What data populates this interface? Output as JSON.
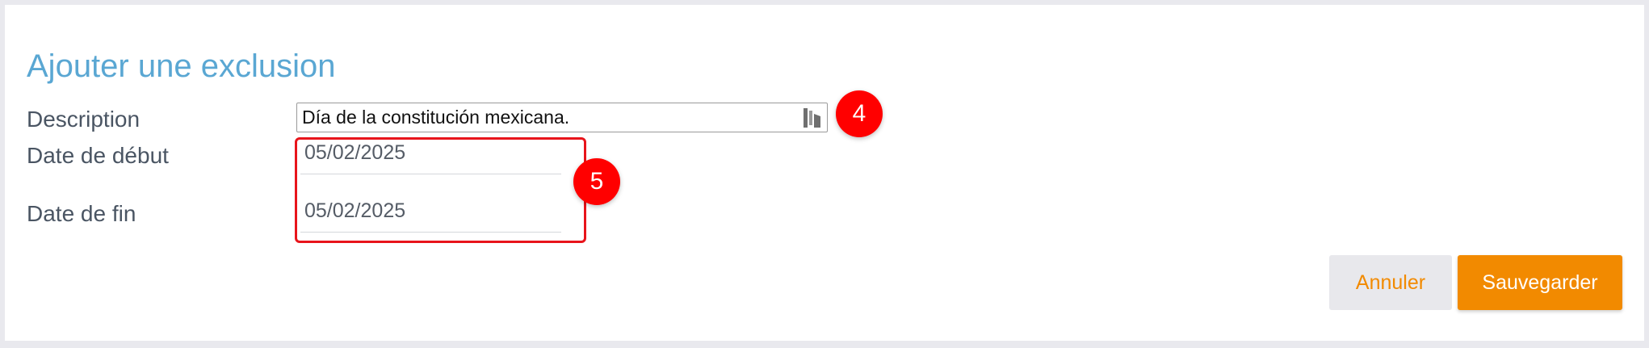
{
  "dialog": {
    "title": "Ajouter une exclusion"
  },
  "form": {
    "description_label": "Description",
    "description_value": "Día de la constitución mexicana.",
    "start_date_label": "Date de début",
    "start_date_value": "05/02/2025",
    "end_date_label": "Date de fin",
    "end_date_value": "05/02/2025"
  },
  "annotations": {
    "step_4": "4",
    "step_5": "5",
    "badge_color": "#ff0000",
    "highlight_color": "#e8141b"
  },
  "buttons": {
    "cancel_label": "Annuler",
    "save_label": "Sauvegarder"
  },
  "colors": {
    "title": "#5aa7d3",
    "accent": "#f28a00",
    "label": "#4a5563"
  },
  "icons": {
    "description_field_icon": "languagetool-icon"
  }
}
